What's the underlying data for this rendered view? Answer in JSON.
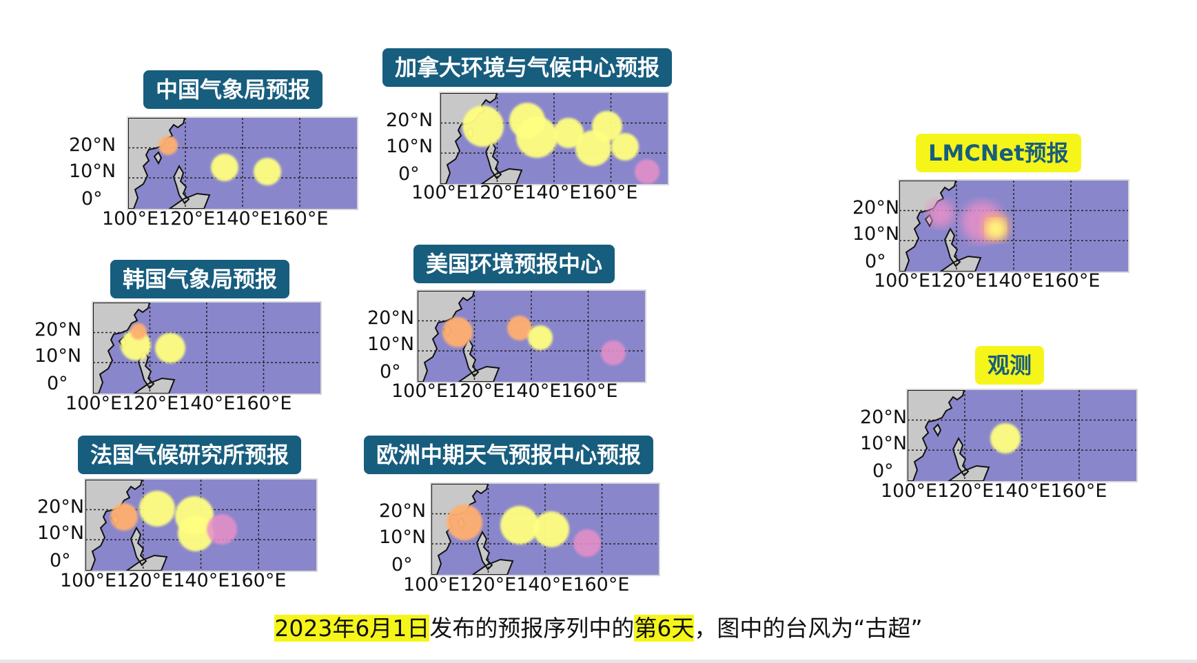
{
  "panels": [
    {
      "title": "中国气象局预报",
      "style": "blue"
    },
    {
      "title": "加拿大环境与气候中心预报",
      "style": "blue"
    },
    {
      "title": "韩国气象局预报",
      "style": "blue"
    },
    {
      "title": "美国环境预报中心",
      "style": "blue"
    },
    {
      "title": "法国气候研究所预报",
      "style": "blue"
    },
    {
      "title": "欧洲中期天气预报中心预报",
      "style": "blue"
    },
    {
      "title": "LMCNet预报",
      "style": "yellow"
    },
    {
      "title": "观测",
      "style": "yellow"
    }
  ],
  "axes": {
    "lat_labels": [
      "20°N",
      "10°N",
      "0°"
    ],
    "lon_labels": "100°E120°E140°E160°E"
  },
  "caption": {
    "date": "2023年6月1日",
    "mid": "发布的预报序列中的",
    "day": "第6天",
    "end": "，图中的台风为“古超”"
  },
  "colors": {
    "title_blue": "#175d7e",
    "title_yellow": "#f5f51a",
    "ocean": "#8a86cc",
    "land": "#c8c8c8",
    "blob_yellow": "#ffff80",
    "blob_orange": "#ffb070",
    "blob_pink": "#e890c8"
  }
}
